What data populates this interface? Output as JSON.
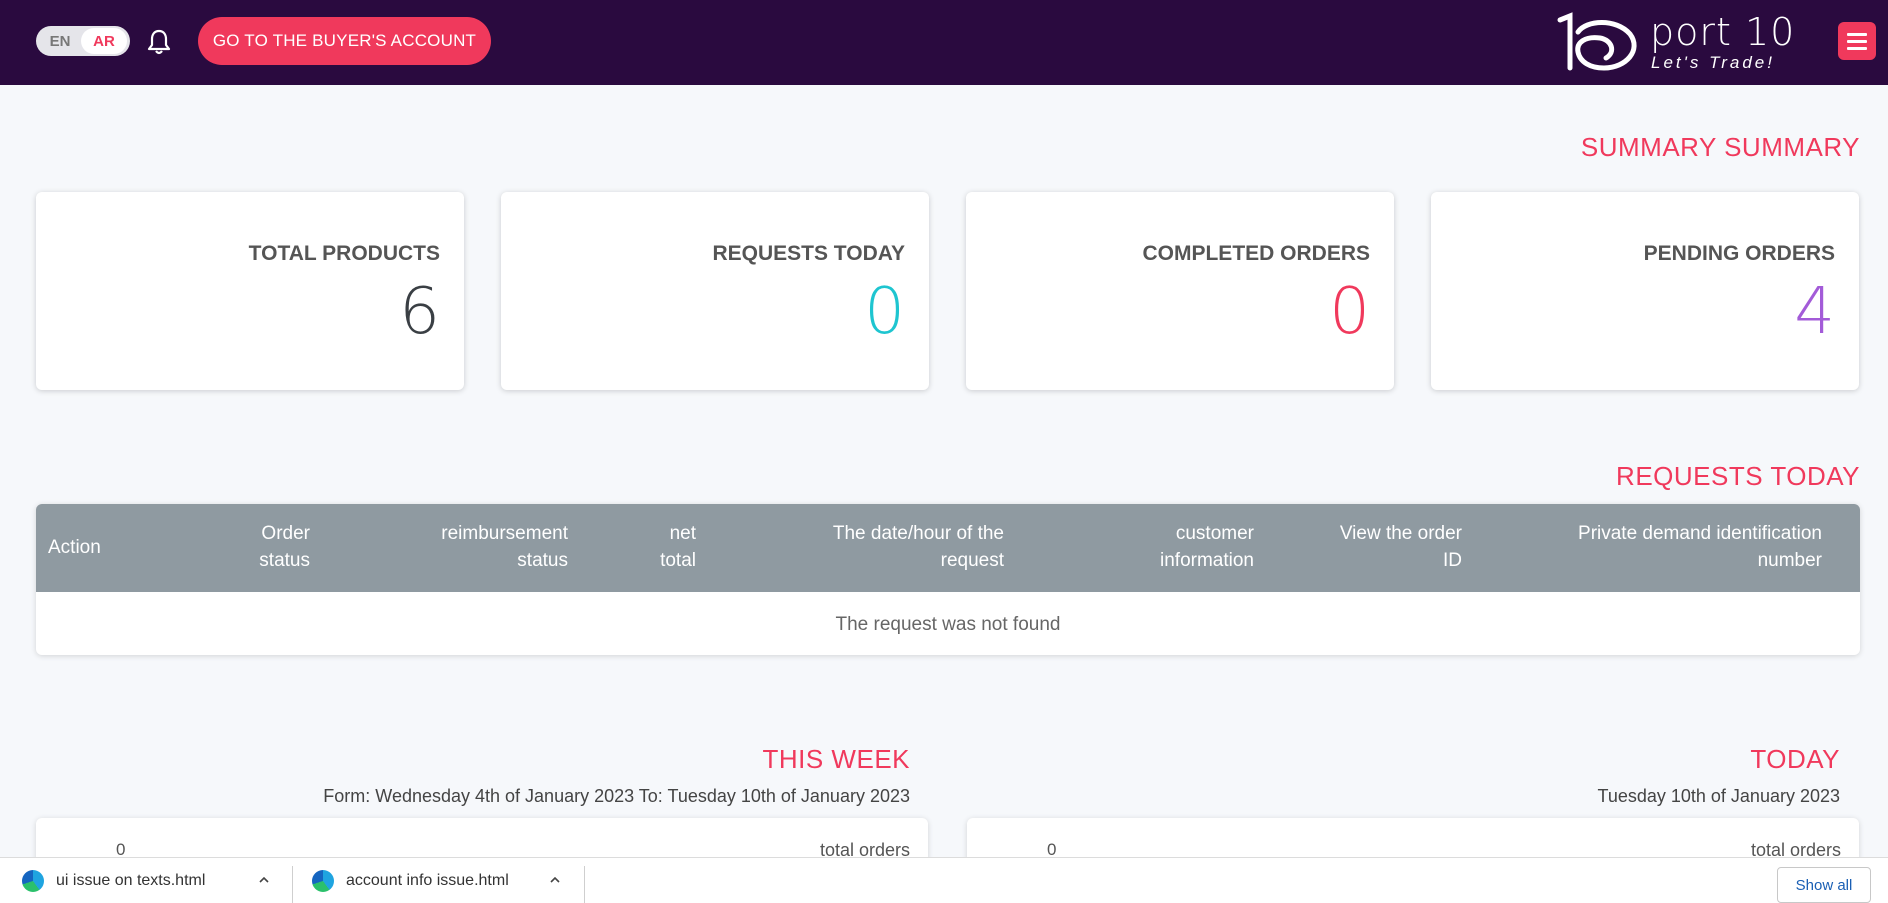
{
  "header": {
    "lang_en": "EN",
    "lang_ar": "AR",
    "buyer_button": "GO TO THE BUYER'S ACCOUNT",
    "logo_name": "port 10",
    "logo_tagline": "Let's Trade!",
    "accent_color": "#f0395c",
    "bar_color": "#2a0a3f"
  },
  "summary": {
    "title": "SUMMARY SUMMARY",
    "cards": [
      {
        "label": "TOTAL PRODUCTS",
        "value": "6",
        "color": "#3a3f44"
      },
      {
        "label": "REQUESTS TODAY",
        "value": "0",
        "color": "#1ec5d0"
      },
      {
        "label": "COMPLETED ORDERS",
        "value": "0",
        "color": "#f0395c"
      },
      {
        "label": "PENDING ORDERS",
        "value": "4",
        "color": "#a35bd8"
      }
    ]
  },
  "requests": {
    "title": "REQUESTS TODAY",
    "columns": [
      {
        "line1": "Action",
        "line2": ""
      },
      {
        "line1": "Order",
        "line2": "status"
      },
      {
        "line1": "reimbursement",
        "line2": "status"
      },
      {
        "line1": "net",
        "line2": "total"
      },
      {
        "line1": "The date/hour of the",
        "line2": "request"
      },
      {
        "line1": "customer",
        "line2": "information"
      },
      {
        "line1": "View the order",
        "line2": "ID"
      },
      {
        "line1": "Private demand identification",
        "line2": "number"
      }
    ],
    "empty_message": "The request was not found"
  },
  "this_week": {
    "title": "THIS WEEK",
    "range": "Form: Wednesday 4th of January 2023 To: Tuesday 10th of January 2023",
    "count": "0",
    "label": "total orders"
  },
  "today": {
    "title": "TODAY",
    "date": "Tuesday 10th of January 2023",
    "count": "0",
    "label": "total orders"
  },
  "downloads": {
    "items": [
      {
        "name": "ui issue on texts.html"
      },
      {
        "name": "account info issue.html"
      }
    ],
    "show_all": "Show all"
  }
}
